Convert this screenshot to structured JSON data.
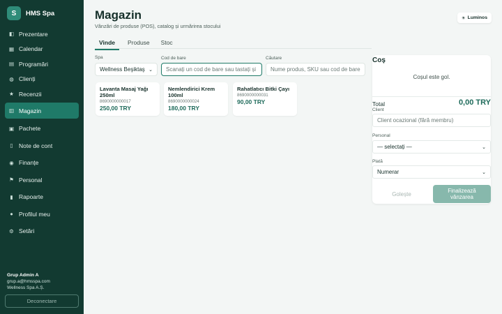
{
  "brand": {
    "logo_letter": "S",
    "name": "HMS Spa"
  },
  "sidebar": {
    "items": [
      {
        "label": "Prezentare",
        "icon": "dashboard-icon",
        "glyph": "◧"
      },
      {
        "label": "Calendar",
        "icon": "calendar-icon",
        "glyph": "▦"
      },
      {
        "label": "Programări",
        "icon": "appointments-icon",
        "glyph": "▤"
      },
      {
        "label": "Clienți",
        "icon": "clients-icon",
        "glyph": "◍"
      },
      {
        "label": "Recenzii",
        "icon": "star-icon",
        "glyph": "★"
      },
      {
        "label": "Magazin",
        "icon": "shop-icon",
        "glyph": "▥"
      },
      {
        "label": "Pachete",
        "icon": "package-icon",
        "glyph": "▣"
      },
      {
        "label": "Note de cont",
        "icon": "bill-icon",
        "glyph": "▯"
      },
      {
        "label": "Finanțe",
        "icon": "money-bag-icon",
        "glyph": "◉"
      },
      {
        "label": "Personal",
        "icon": "staff-icon",
        "glyph": "⚑"
      },
      {
        "label": "Rapoarte",
        "icon": "chart-icon",
        "glyph": "▮"
      },
      {
        "label": "Profilul meu",
        "icon": "profile-icon",
        "glyph": "●"
      },
      {
        "label": "Setări",
        "icon": "gear-icon",
        "glyph": "⚙"
      }
    ],
    "active_index": 5,
    "user": {
      "name": "Grup Admin A",
      "email": "grup.a@hmsspa.com",
      "company": "Wellness Spa A.Ș."
    },
    "logout_label": "Deconectare"
  },
  "header": {
    "title": "Magazin",
    "subtitle": "Vânzări de produse (POS), catalog și urmărirea stocului",
    "theme_label": "Luminos",
    "theme_glyph": "☀"
  },
  "tabs": [
    {
      "label": "Vinde",
      "active": true
    },
    {
      "label": "Produse",
      "active": false
    },
    {
      "label": "Stoc",
      "active": false
    }
  ],
  "filters": {
    "spa_label": "Spa",
    "spa_value": "Wellness Beşiktaş",
    "barcode_label": "Cod de bare",
    "barcode_placeholder": "Scanați un cod de bare sau tastați și",
    "search_label": "Căutare",
    "search_placeholder": "Nume produs, SKU sau cod de bare..."
  },
  "products": [
    {
      "name": "Lavanta Masaj Yağı 250ml",
      "code": "8690000000017",
      "price": "250,00 TRY"
    },
    {
      "name": "Nemlendirici Krem 100ml",
      "code": "8690000000024",
      "price": "180,00 TRY"
    },
    {
      "name": "Rahatlatıcı Bitki Çayı",
      "code": "8690000000031",
      "price": "90,00 TRY"
    }
  ],
  "cart": {
    "title": "Coș",
    "empty_text": "Coșul este gol.",
    "total_label": "Total",
    "total_value": "0,00 TRY",
    "client_label": "Client",
    "client_placeholder": "Client ocazional (fără membru)",
    "staff_label": "Personal",
    "staff_value": "— selectați —",
    "payment_label": "Plată",
    "payment_value": "Numerar",
    "clear_label": "Golește",
    "finish_label": "Finalizează vânzarea"
  },
  "colors": {
    "sidebar": "#123a31",
    "accent": "#1f7a68",
    "price": "#1f6b5b"
  }
}
